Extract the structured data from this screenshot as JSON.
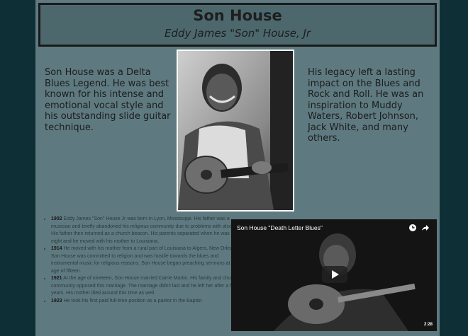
{
  "header": {
    "title": "Son House",
    "subtitle": "Eddy James \"Son\" House, Jr"
  },
  "intro": {
    "left": "Son House was a Delta Blues Legend. He was best known for his intense and emotional vocal style and his outstanding slide guitar technique.",
    "right": "His legacy left a lasting impact on the Blues and Rock and Roll. He was an inspiration to Muddy Waters, Robert Johnson, Jack White, and many others."
  },
  "timeline": [
    {
      "year": "1902",
      "text": "Eddy James \"Son\" House Jr was born in Lyon, Mississippi. His father was a musician and briefly abandoned his religious community due to problems with alcohol. His father then returned as a church beacon. His parents separated when he was eight and he moved with his mother to Louisiana."
    },
    {
      "year": "1914",
      "text": "He moved with his mother from a rural part of Louisiana to Algers, New Orleans. Son House was committed to religion and was hostile towards the blues and instrumental music for religious reasons. Son House began preaching sermons at the age of fifteen."
    },
    {
      "year": "1921",
      "text": "At the age of nineteen, Son House married Carrie Martin. His family and church community opposed this marriage. The marriage didn't last and he left her after a few years. His mother died around this time as well."
    },
    {
      "year": "1923",
      "text": "He took his first paid full-time position as a pastor in the Baptist"
    }
  ],
  "video": {
    "title": "Son House \"Death Letter Blues\"",
    "duration": "2:28",
    "icons": [
      "clock-icon",
      "share-icon",
      "play-icon"
    ]
  }
}
